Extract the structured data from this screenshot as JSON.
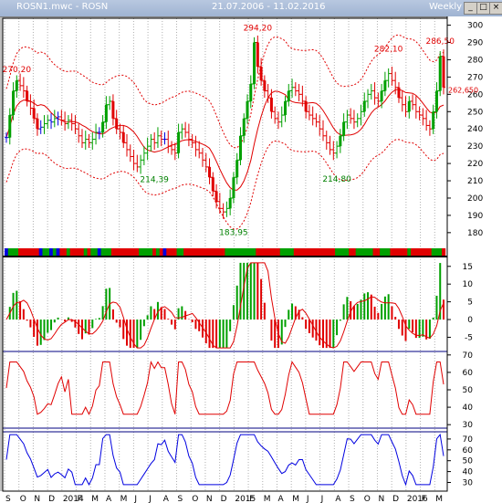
{
  "window": {
    "title": "ROSN1.mwc - ROSN",
    "date_range": "21.07.2006 - 11.02.2016",
    "period": "Weekly",
    "buttons": [
      "_",
      "□",
      "×"
    ]
  },
  "colors": {
    "background": "#ffffff",
    "up_bar": "#00a000",
    "down_bar": "#e00000",
    "neutral_bar": "#0000e0",
    "envelope": "#e00000",
    "oscillator_line": "#e00000",
    "bottom_line": "#0000e0"
  },
  "chart_data": [
    {
      "type": "ohlc",
      "y_ticks": [
        180,
        190,
        200,
        210,
        220,
        230,
        240,
        250,
        260,
        270,
        280,
        290,
        300
      ],
      "ylim": [
        172,
        304
      ],
      "annotations": [
        {
          "text": "270,20",
          "value": 270.2,
          "week": 3
        },
        {
          "text": "294,20",
          "value": 294.2,
          "week": 73
        },
        {
          "text": "282,10",
          "value": 282.1,
          "week": 111
        },
        {
          "text": "286,50",
          "value": 286.5,
          "week": 126
        },
        {
          "text": "262,650",
          "value": 262.65,
          "week": 126
        },
        {
          "text": "214,39",
          "value": 214.39,
          "week": 43
        },
        {
          "text": "183,95",
          "value": 183.95,
          "week": 66
        },
        {
          "text": "214,80",
          "value": 214.8,
          "week": 96
        }
      ],
      "closes": [
        235,
        248,
        262,
        268,
        265,
        262,
        256,
        252,
        246,
        240,
        241,
        243,
        245,
        244,
        246,
        247,
        245,
        243,
        245,
        243,
        240,
        236,
        232,
        234,
        232,
        234,
        238,
        238,
        244,
        254,
        256,
        246,
        240,
        238,
        232,
        228,
        224,
        220,
        218,
        222,
        226,
        230,
        234,
        232,
        236,
        234,
        234,
        230,
        228,
        226,
        238,
        240,
        238,
        234,
        232,
        228,
        226,
        222,
        218,
        212,
        204,
        198,
        194,
        192,
        194,
        200,
        212,
        222,
        236,
        246,
        256,
        266,
        290,
        276,
        268,
        262,
        258,
        250,
        246,
        244,
        248,
        256,
        262,
        264,
        262,
        260,
        256,
        250,
        248,
        246,
        244,
        240,
        236,
        232,
        228,
        226,
        230,
        236,
        244,
        248,
        246,
        244,
        246,
        250,
        256,
        260,
        262,
        258,
        256,
        262,
        268,
        272,
        268,
        264,
        258,
        254,
        250,
        256,
        254,
        250,
        248,
        246,
        242,
        240,
        250,
        262,
        282,
        264
      ]
    },
    {
      "type": "bar",
      "name": "histogram",
      "y_ticks": [
        -5,
        0,
        5,
        10,
        15
      ],
      "ylim": [
        -9,
        17
      ]
    },
    {
      "type": "line",
      "name": "oscillator",
      "y_ticks": [
        30,
        40,
        50,
        60,
        70
      ],
      "ylim": [
        28,
        72
      ]
    },
    {
      "type": "line",
      "name": "lower",
      "y_ticks": [
        30,
        40,
        50,
        60,
        70
      ],
      "ylim": [
        22,
        80
      ]
    }
  ],
  "x_axis": {
    "labels": [
      "S",
      "O",
      "N",
      "D",
      "2014",
      "F",
      "M",
      "A",
      "M",
      "J",
      "J",
      "A",
      "S",
      "O",
      "N",
      "D",
      "2015",
      "F",
      "M",
      "A",
      "M",
      "J",
      "J",
      "A",
      "S",
      "O",
      "N",
      "D",
      "2016",
      "F",
      "M"
    ]
  }
}
